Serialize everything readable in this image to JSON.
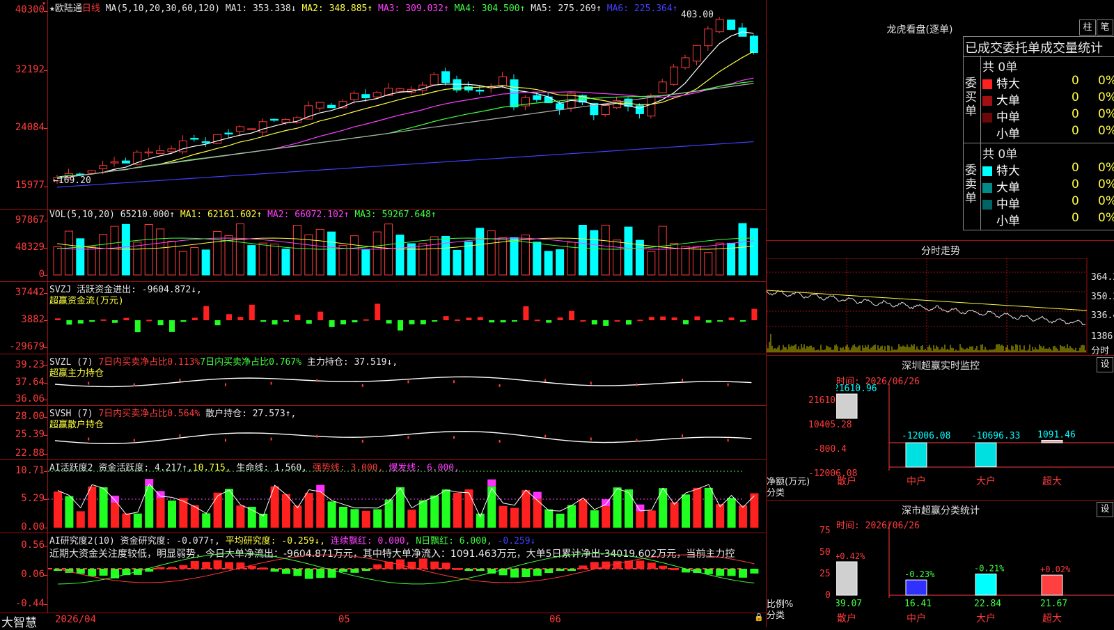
{
  "main": {
    "title_stock": "★欧陆通",
    "period": "日线",
    "ma_spec": "MA(5,10,20,30,60,120)",
    "ma1": "MA1: 353.338↓",
    "ma2": "MA2: 348.885↑",
    "ma3": "MA3: 309.032↑",
    "ma4": "MA4: 304.500↑",
    "ma5": "MA5: 275.269↑",
    "ma6": "MA6: 225.364↑",
    "y_labels": [
      "40300",
      "32192",
      "24084",
      "15977"
    ],
    "high_label": "403.00",
    "low_label": "←169.20",
    "colors": {
      "up": "#ff3b3b",
      "down": "#00ffff",
      "ma1": "#ffffff",
      "ma2": "#ffff40",
      "ma3": "#ff40ff",
      "ma4": "#40ff40",
      "ma5": "#b0b0b0",
      "ma6": "#4040ff"
    }
  },
  "vol": {
    "header": "VOL(5,10,20)",
    "val": "65210.000↑",
    "ma1": "MA1: 62161.602↑",
    "ma2": "MA2: 66072.102↑",
    "ma3": "MA3: 59267.648↑",
    "y_labels": [
      "97867",
      "48329",
      "0"
    ]
  },
  "svzj": {
    "header": "SVZJ  活跃资金进出: -9604.872↓,",
    "sub": "超赢资金流(万元)",
    "y_labels": [
      "37442",
      "3882",
      "-29679"
    ]
  },
  "svzl": {
    "name": "SVZL (7)",
    "a": "7日内买卖净占比0.113%",
    "b": "7日内买卖净占比0.767%",
    "c": "主力持仓: 37.519↓,",
    "sub": "超赢主力持仓",
    "y_labels": [
      "39.23",
      "37.64",
      "36.06"
    ]
  },
  "svsh": {
    "name": "SVSH (7)",
    "a": "7日内买卖净占比0.564%",
    "c": "散户持仓: 27.573↑,",
    "sub": "超赢散户持仓",
    "y_labels": [
      "28.00",
      "25.39",
      "22.88"
    ]
  },
  "ai2": {
    "name": "AI活跃度2",
    "a": "资金活跃度: 4.217↑,",
    "b": "10.715,",
    "c": "生命线: 1.560,",
    "d": "强势线: 3.000,",
    "e": "爆发线: 6.000,",
    "y_labels": [
      "10.71",
      "5.29",
      "0.00"
    ]
  },
  "ai3": {
    "name": "AI研究度2(10)",
    "a": "资金研究度: -0.077↑,",
    "b": "平均研究度: -0.259↓,",
    "c": "连续飘红: 0.000,",
    "d": "N日飘红: 6.000,",
    "e": "-0.259↓",
    "comment": "近期大资金关注度较低，明显弱势，今日大单净流出：-9604.871万元，其中特大单净流入：1091.463万元，大单5日累计净出-34019.602万元，当前主力控",
    "y_labels": [
      "0.56",
      "0.06",
      "-0.44"
    ]
  },
  "bottom": {
    "brand": "大智慧",
    "dates": [
      "2026/04",
      "05",
      "06"
    ]
  },
  "right_top": {
    "title": "龙虎看盘(逐单)",
    "btn_bar": "柱",
    "btn_pen": "笔",
    "tabs": "已成交委托单成交量统计",
    "buy_side": "委买单",
    "sell_side": "委卖单",
    "buy_total": "共 0单",
    "sell_total": "共 0单",
    "buy_rows": [
      {
        "label": "特大",
        "count": "0",
        "pct": "0%",
        "color": "#ff2020"
      },
      {
        "label": "大单",
        "count": "0",
        "pct": "0%",
        "color": "#a01010"
      },
      {
        "label": "中单",
        "count": "0",
        "pct": "0%",
        "color": "#6a0808"
      },
      {
        "label": "小单",
        "count": "0",
        "pct": "0%",
        "color": "#000000"
      }
    ],
    "sell_rows": [
      {
        "label": "特大",
        "count": "0",
        "pct": "0%",
        "color": "#00ffff"
      },
      {
        "label": "大单",
        "count": "0",
        "pct": "0%",
        "color": "#008a8a"
      },
      {
        "label": "中单",
        "count": "0",
        "pct": "0%",
        "color": "#006464"
      },
      {
        "label": "小单",
        "count": "0",
        "pct": "0%",
        "color": "#000000"
      }
    ]
  },
  "intraday": {
    "title": "分时走势",
    "y_labels": [
      "364.2",
      "350.3",
      "336.4"
    ],
    "vol_label": "1386",
    "x_label": "分时"
  },
  "sz_monitor": {
    "title": "深圳超赢实时监控",
    "set": "设",
    "time": "时间: 2026/06/26",
    "y_labels": [
      "21610.96",
      "10405.28",
      "-800.4",
      "-12006.08"
    ],
    "unit": "净额(万元)",
    "unit2": "分类",
    "bars": [
      {
        "name": "散户",
        "value": "21610.96"
      },
      {
        "name": "中户",
        "value": "-12006.08"
      },
      {
        "name": "大户",
        "value": "-10696.33"
      },
      {
        "name": "超大",
        "value": "1091.46"
      }
    ]
  },
  "sz_class": {
    "title": "深市超赢分类统计",
    "set": "设",
    "time": "时间: 2026/06/26",
    "y_labels": [
      "75",
      "50",
      "25",
      "0"
    ],
    "unit": "比例%",
    "unit2": "分类",
    "bars": [
      {
        "name": "散户",
        "value": "39.07",
        "chg": "+0.42%"
      },
      {
        "name": "中户",
        "value": "16.41",
        "chg": "-0.23%"
      },
      {
        "name": "大户",
        "value": "22.84",
        "chg": "-0.21%"
      },
      {
        "name": "超大",
        "value": "21.67",
        "chg": "+0.02%"
      }
    ]
  }
}
